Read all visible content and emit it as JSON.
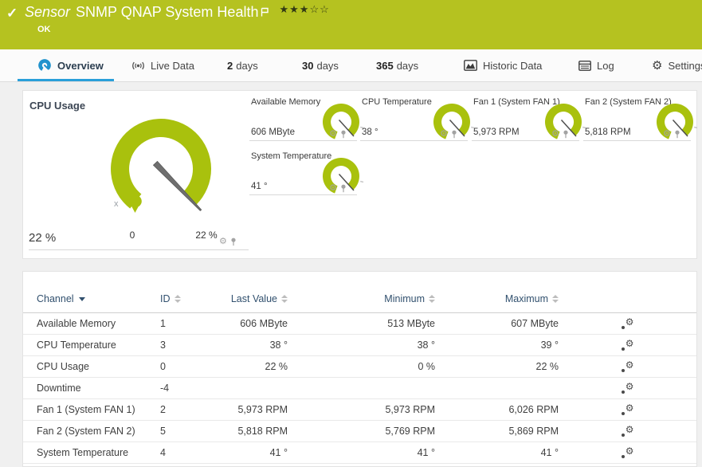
{
  "colors": {
    "status_ok_green": "#b5c220",
    "gauge_green": "#a9c10d",
    "accent_blue": "#2a9fd9"
  },
  "header": {
    "check_icon": "✓",
    "type_label": "Sensor",
    "title": "SNMP QNAP System Health",
    "status": "OK",
    "rating": {
      "filled_stars": "★★★",
      "empty_stars": "☆☆"
    }
  },
  "tabs": [
    {
      "label": "Overview",
      "active": true
    },
    {
      "label": "Live Data"
    },
    {
      "num": "2",
      "label": "days"
    },
    {
      "num": "30",
      "label": "days"
    },
    {
      "num": "365",
      "label": "days"
    },
    {
      "label": "Historic Data"
    },
    {
      "label": "Log"
    },
    {
      "label": "Settings"
    }
  ],
  "icons": {
    "gear_glyph": "⚙"
  },
  "gauge_panel": {
    "main": {
      "title": "CPU Usage",
      "value": "22 %",
      "scale_min": "0",
      "scale_max": "22 %",
      "marker": "x"
    },
    "small": [
      {
        "title": "Available Memory",
        "value": "606 MByte"
      },
      {
        "title": "CPU Temperature",
        "value": "38 °"
      },
      {
        "title": "Fan 1 (System FAN 1)",
        "value": "5,973 RPM"
      },
      {
        "title": "Fan 2 (System FAN 2)",
        "value": "5,818 RPM"
      },
      {
        "title": "System Temperature",
        "value": "41 °"
      }
    ]
  },
  "table": {
    "columns": [
      "Channel",
      "ID",
      "Last Value",
      "Minimum",
      "Maximum"
    ],
    "rows": [
      {
        "channel": "Available Memory",
        "id": "1",
        "last": "606 MByte",
        "min": "513 MByte",
        "max": "607 MByte"
      },
      {
        "channel": "CPU Temperature",
        "id": "3",
        "last": "38 °",
        "min": "38 °",
        "max": "39 °"
      },
      {
        "channel": "CPU Usage",
        "id": "0",
        "last": "22 %",
        "min": "0 %",
        "max": "22 %"
      },
      {
        "channel": "Downtime",
        "id": "-4",
        "last": "",
        "min": "",
        "max": ""
      },
      {
        "channel": "Fan 1 (System FAN 1)",
        "id": "2",
        "last": "5,973 RPM",
        "min": "5,973 RPM",
        "max": "6,026 RPM"
      },
      {
        "channel": "Fan 2 (System FAN 2)",
        "id": "5",
        "last": "5,818 RPM",
        "min": "5,769 RPM",
        "max": "5,869 RPM"
      },
      {
        "channel": "System Temperature",
        "id": "4",
        "last": "41 °",
        "min": "41 °",
        "max": "41 °"
      }
    ]
  }
}
